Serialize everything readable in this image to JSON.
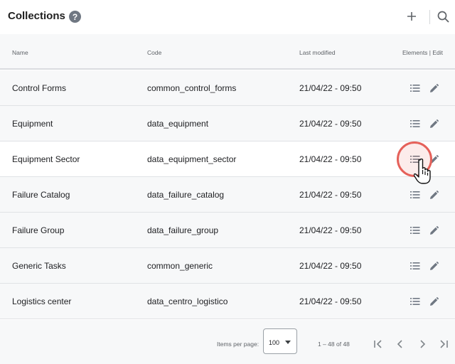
{
  "header": {
    "title": "Collections",
    "help_glyph": "?",
    "add_glyph": "+"
  },
  "columns": {
    "name": "Name",
    "code": "Code",
    "modified": "Last modified",
    "actions": "Elements | Edit"
  },
  "rows": [
    {
      "name": "Control Forms",
      "code": "common_control_forms",
      "modified": "21/04/22 - 09:50"
    },
    {
      "name": "Equipment",
      "code": "data_equipment",
      "modified": "21/04/22 - 09:50"
    },
    {
      "name": "Equipment Sector",
      "code": "data_equipment_sector",
      "modified": "21/04/22 - 09:50"
    },
    {
      "name": "Failure Catalog",
      "code": "data_failure_catalog",
      "modified": "21/04/22 - 09:50"
    },
    {
      "name": "Failure Group",
      "code": "data_failure_group",
      "modified": "21/04/22 - 09:50"
    },
    {
      "name": "Generic Tasks",
      "code": "common_generic",
      "modified": "21/04/22 - 09:50"
    },
    {
      "name": "Logistics center",
      "code": "data_centro_logistico",
      "modified": "21/04/22 - 09:50"
    }
  ],
  "highlighted_row": "Equipment Sector",
  "pagination": {
    "items_per_page_label": "Items per page:",
    "items_per_page_value": "100",
    "range": "1 – 48 of 48"
  },
  "colors": {
    "accent_ripple": "#e5615a",
    "icon": "#6f7782",
    "row_bg": "#f7f8f9"
  },
  "icons": {
    "help": "help-circle-icon",
    "add": "plus-icon",
    "search": "search-icon",
    "elements": "list-icon",
    "edit": "pencil-icon",
    "first": "first-page-icon",
    "prev": "chevron-left-icon",
    "next": "chevron-right-icon",
    "last": "last-page-icon"
  }
}
